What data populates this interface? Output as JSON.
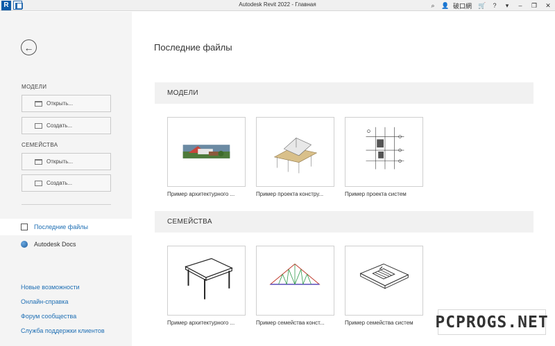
{
  "titlebar": {
    "title": "Autodesk Revit 2022 - Главная",
    "logo_letter": "R",
    "user": "破口網",
    "minimize": "‒",
    "restore": "❐",
    "close": "✕",
    "help": "?",
    "help_caret": "▾",
    "cart": "🛒",
    "binoculars": "⌕",
    "user_icon": "👤"
  },
  "leftpane": {
    "back_glyph": "←",
    "models_heading": "МОДЕЛИ",
    "families_heading": "СЕМЕЙСТВА",
    "models_open": "Открыть...",
    "models_create": "Создать...",
    "families_open": "Открыть...",
    "families_create": "Создать...",
    "nav": [
      {
        "label": "Последние файлы"
      },
      {
        "label": "Autodesk Docs"
      }
    ],
    "links": [
      "Новые возможности",
      "Онлайн-справка",
      "Форум сообщества",
      "Служба поддержки клиентов"
    ]
  },
  "main": {
    "title": "Последние файлы",
    "models_band": "МОДЕЛИ",
    "families_band": "СЕМЕЙСТВА",
    "models": [
      {
        "label": "Пример архитектурного ..."
      },
      {
        "label": "Пример проекта констру..."
      },
      {
        "label": "Пример проекта систем"
      }
    ],
    "families": [
      {
        "label": "Пример архитектурного ..."
      },
      {
        "label": "Пример семейства конст..."
      },
      {
        "label": "Пример семейства систем"
      }
    ]
  },
  "watermark": "PCPROGS.NET",
  "colors": {
    "accent": "#1f6fb4",
    "revit_blue": "#0b5ba8",
    "sidebar_bg": "#f4f4f4",
    "band_bg": "#f1f1f1"
  }
}
